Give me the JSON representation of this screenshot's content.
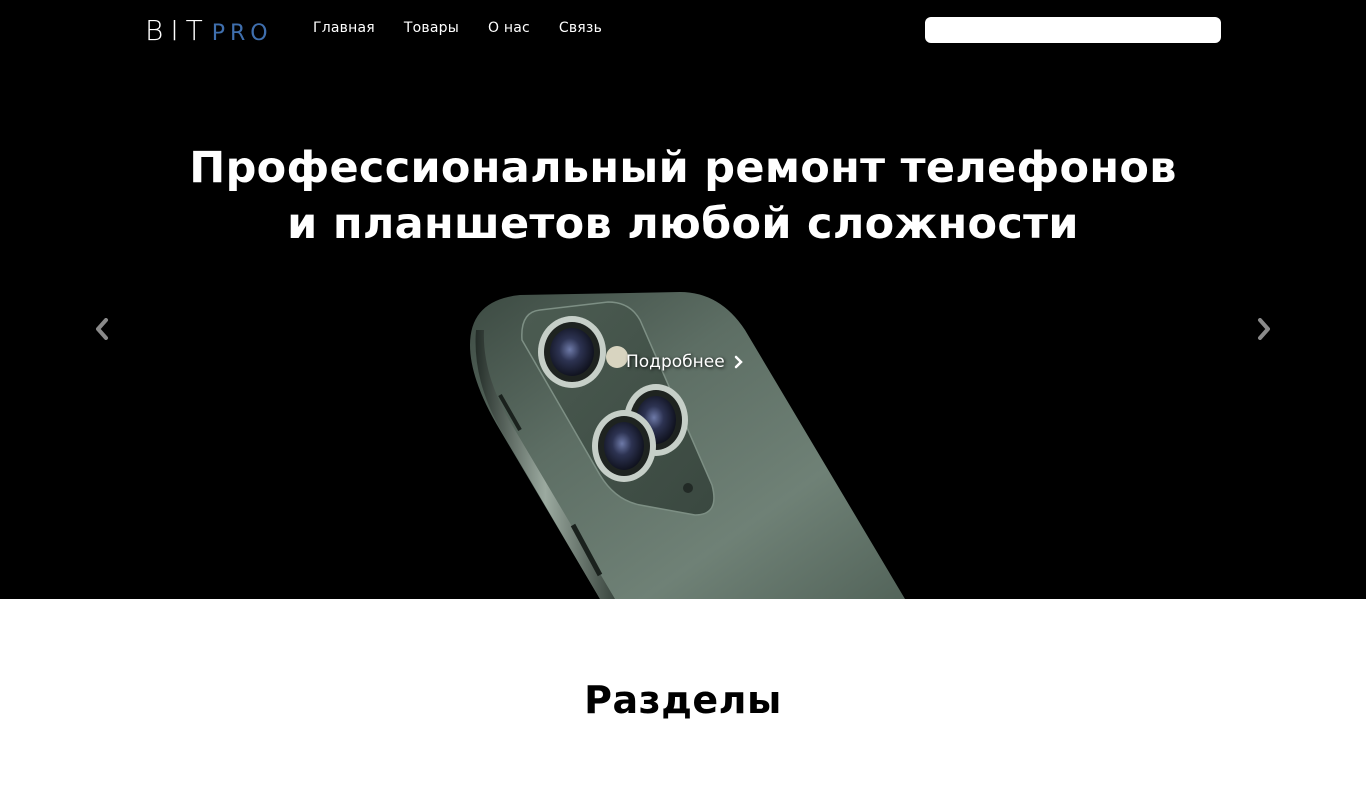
{
  "brand": {
    "part1": "BIT",
    "part2": "PRO",
    "accent_color": "#3f6fae"
  },
  "nav": {
    "items": [
      {
        "label": "Главная"
      },
      {
        "label": "Товары"
      },
      {
        "label": "О нас"
      },
      {
        "label": "Связь"
      }
    ]
  },
  "search": {
    "placeholder": "",
    "value": ""
  },
  "hero": {
    "title_line1": "Профессиональный ремонт телефонов",
    "title_line2": "и планшетов любой сложности",
    "link_label": "Подробнее",
    "image_subject": "smartphone-triple-camera"
  },
  "carousel": {
    "prev_icon": "chevron-left-icon",
    "next_icon": "chevron-right-icon"
  },
  "sections": {
    "title": "Разделы"
  }
}
